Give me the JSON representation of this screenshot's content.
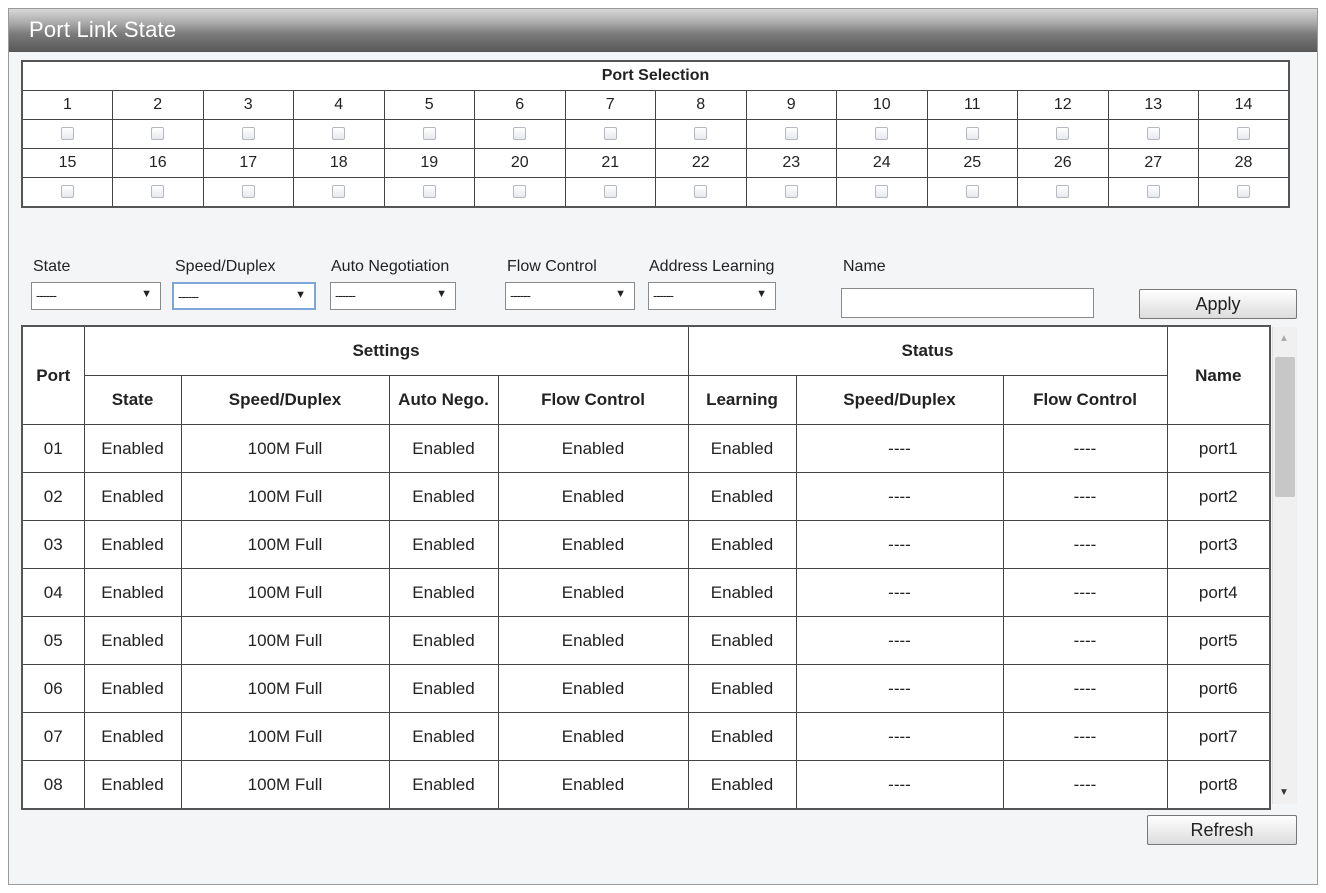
{
  "window": {
    "title": "Port Link State"
  },
  "port_selection": {
    "header": "Port Selection",
    "ports_row1": [
      "1",
      "2",
      "3",
      "4",
      "5",
      "6",
      "7",
      "8",
      "9",
      "10",
      "11",
      "12",
      "13",
      "14"
    ],
    "ports_row2": [
      "15",
      "16",
      "17",
      "18",
      "19",
      "20",
      "21",
      "22",
      "23",
      "24",
      "25",
      "26",
      "27",
      "28"
    ]
  },
  "filters": {
    "state_label": "State",
    "speed_label": "Speed/Duplex",
    "autoneg_label": "Auto Negotiation",
    "flow_label": "Flow Control",
    "addr_label": "Address Learning",
    "name_label": "Name",
    "state_value": "------",
    "speed_value": "------",
    "autoneg_value": "------",
    "flow_value": "------",
    "addr_value": "------",
    "name_value": "",
    "apply_label": "Apply"
  },
  "table": {
    "port_header": "Port",
    "settings_header": "Settings",
    "status_header": "Status",
    "name_header": "Name",
    "columns": [
      "State",
      "Speed/Duplex",
      "Auto Nego.",
      "Flow Control",
      "Learning",
      "Speed/Duplex",
      "Flow Control"
    ],
    "rows": [
      [
        "01",
        "Enabled",
        "100M Full",
        "Enabled",
        "Enabled",
        "Enabled",
        "----",
        "----",
        "port1"
      ],
      [
        "02",
        "Enabled",
        "100M Full",
        "Enabled",
        "Enabled",
        "Enabled",
        "----",
        "----",
        "port2"
      ],
      [
        "03",
        "Enabled",
        "100M Full",
        "Enabled",
        "Enabled",
        "Enabled",
        "----",
        "----",
        "port3"
      ],
      [
        "04",
        "Enabled",
        "100M Full",
        "Enabled",
        "Enabled",
        "Enabled",
        "----",
        "----",
        "port4"
      ],
      [
        "05",
        "Enabled",
        "100M Full",
        "Enabled",
        "Enabled",
        "Enabled",
        "----",
        "----",
        "port5"
      ],
      [
        "06",
        "Enabled",
        "100M Full",
        "Enabled",
        "Enabled",
        "Enabled",
        "----",
        "----",
        "port6"
      ],
      [
        "07",
        "Enabled",
        "100M Full",
        "Enabled",
        "Enabled",
        "Enabled",
        "----",
        "----",
        "port7"
      ],
      [
        "08",
        "Enabled",
        "100M Full",
        "Enabled",
        "Enabled",
        "Enabled",
        "----",
        "----",
        "port8"
      ]
    ]
  },
  "refresh_label": "Refresh",
  "icons": {
    "dropdown": "chevron-down-icon",
    "scroll_up": "scroll-up-arrow-icon",
    "scroll_down": "scroll-down-arrow-icon"
  }
}
